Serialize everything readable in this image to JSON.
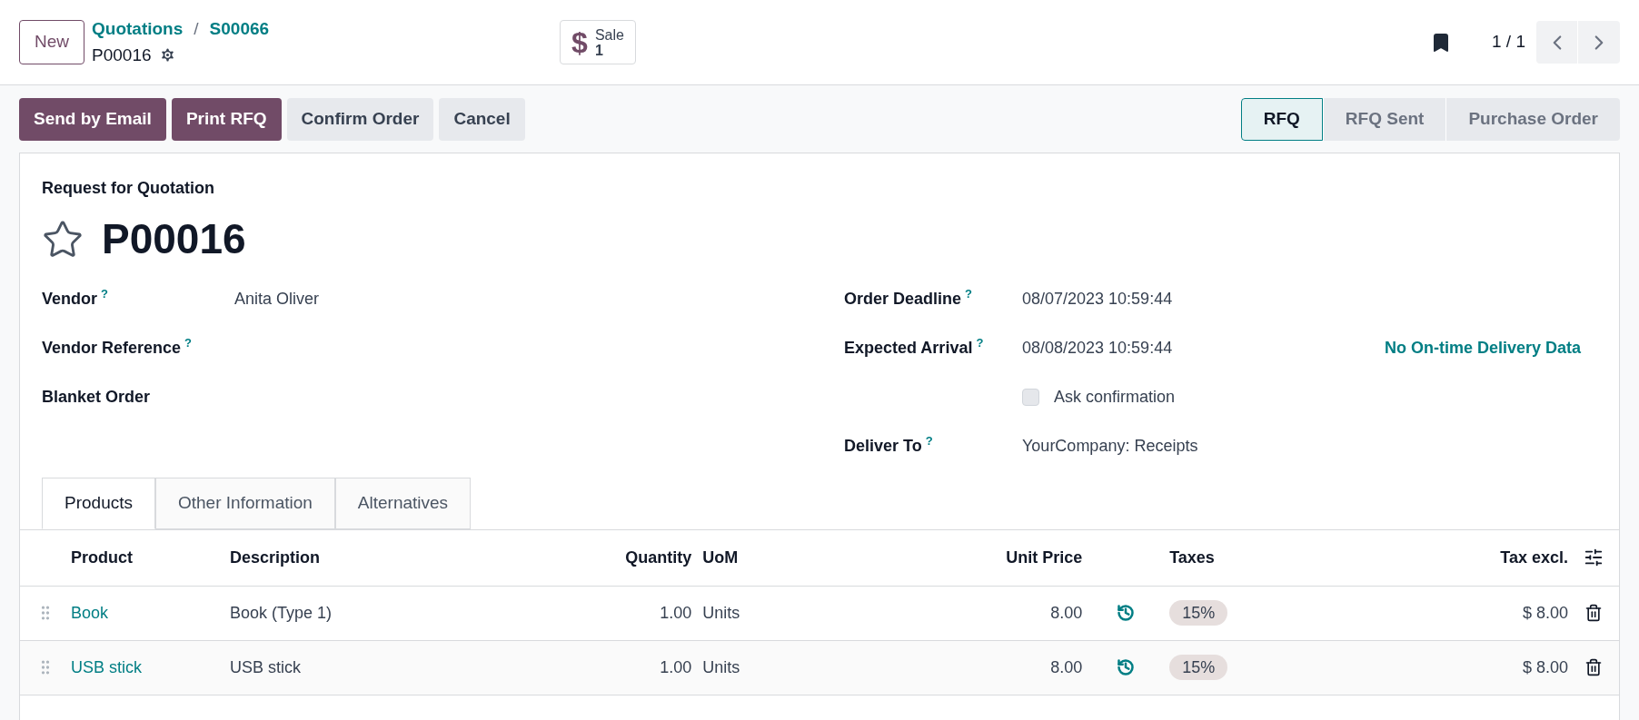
{
  "control_panel": {
    "new_button": "New",
    "breadcrumbs": [
      "Quotations",
      "S00066"
    ],
    "breadcrumb_separator": "/",
    "record": "P00016",
    "smart_button": {
      "symbol": "$",
      "label": "Sale",
      "count": "1"
    },
    "pager": "1 / 1"
  },
  "actions": [
    {
      "label": "Send by Email",
      "primary": true
    },
    {
      "label": "Print RFQ",
      "primary": true
    },
    {
      "label": "Confirm Order",
      "primary": false
    },
    {
      "label": "Cancel",
      "primary": false
    }
  ],
  "statusbar": [
    {
      "label": "RFQ",
      "selected": true
    },
    {
      "label": "RFQ Sent",
      "selected": false
    },
    {
      "label": "Purchase Order",
      "selected": false
    }
  ],
  "form": {
    "subtitle": "Request for Quotation",
    "name": "P00016",
    "starred": false,
    "left_fields": [
      {
        "label": "Vendor",
        "help": "?",
        "value": "Anita Oliver"
      },
      {
        "label": "Vendor Reference",
        "help": "?"
      },
      {
        "label": "Blanket Order"
      }
    ],
    "right_fields": [
      {
        "kind": "text",
        "label": "Order Deadline",
        "help": "?",
        "value": "08/07/2023 10:59:44"
      },
      {
        "kind": "text",
        "label": "Expected Arrival",
        "help": "?",
        "value": "08/08/2023 10:59:44",
        "extra": "No On-time Delivery Data"
      },
      {
        "kind": "checkbox",
        "value": "Ask confirmation",
        "checked": false
      },
      {
        "kind": "text",
        "label": "Deliver To",
        "help": "?",
        "value": "YourCompany: Receipts"
      }
    ]
  },
  "tabs": [
    {
      "label": "Products",
      "selected": true
    },
    {
      "label": "Other Information",
      "selected": false
    },
    {
      "label": "Alternatives",
      "selected": false
    }
  ],
  "table": {
    "columns": [
      "Product",
      "Description",
      "Quantity",
      "UoM",
      "Unit Price",
      "Taxes",
      "Tax excl."
    ],
    "rows": [
      {
        "product": "Book",
        "description": "Book (Type 1)",
        "quantity": "1.00",
        "uom": "Units",
        "unit_price": "8.00",
        "taxes": "15%",
        "subtotal": "$ 8.00"
      },
      {
        "product": "USB stick",
        "description": "USB stick",
        "quantity": "1.00",
        "uom": "Units",
        "unit_price": "8.00",
        "taxes": "15%",
        "subtotal": "$ 8.00"
      }
    ]
  }
}
